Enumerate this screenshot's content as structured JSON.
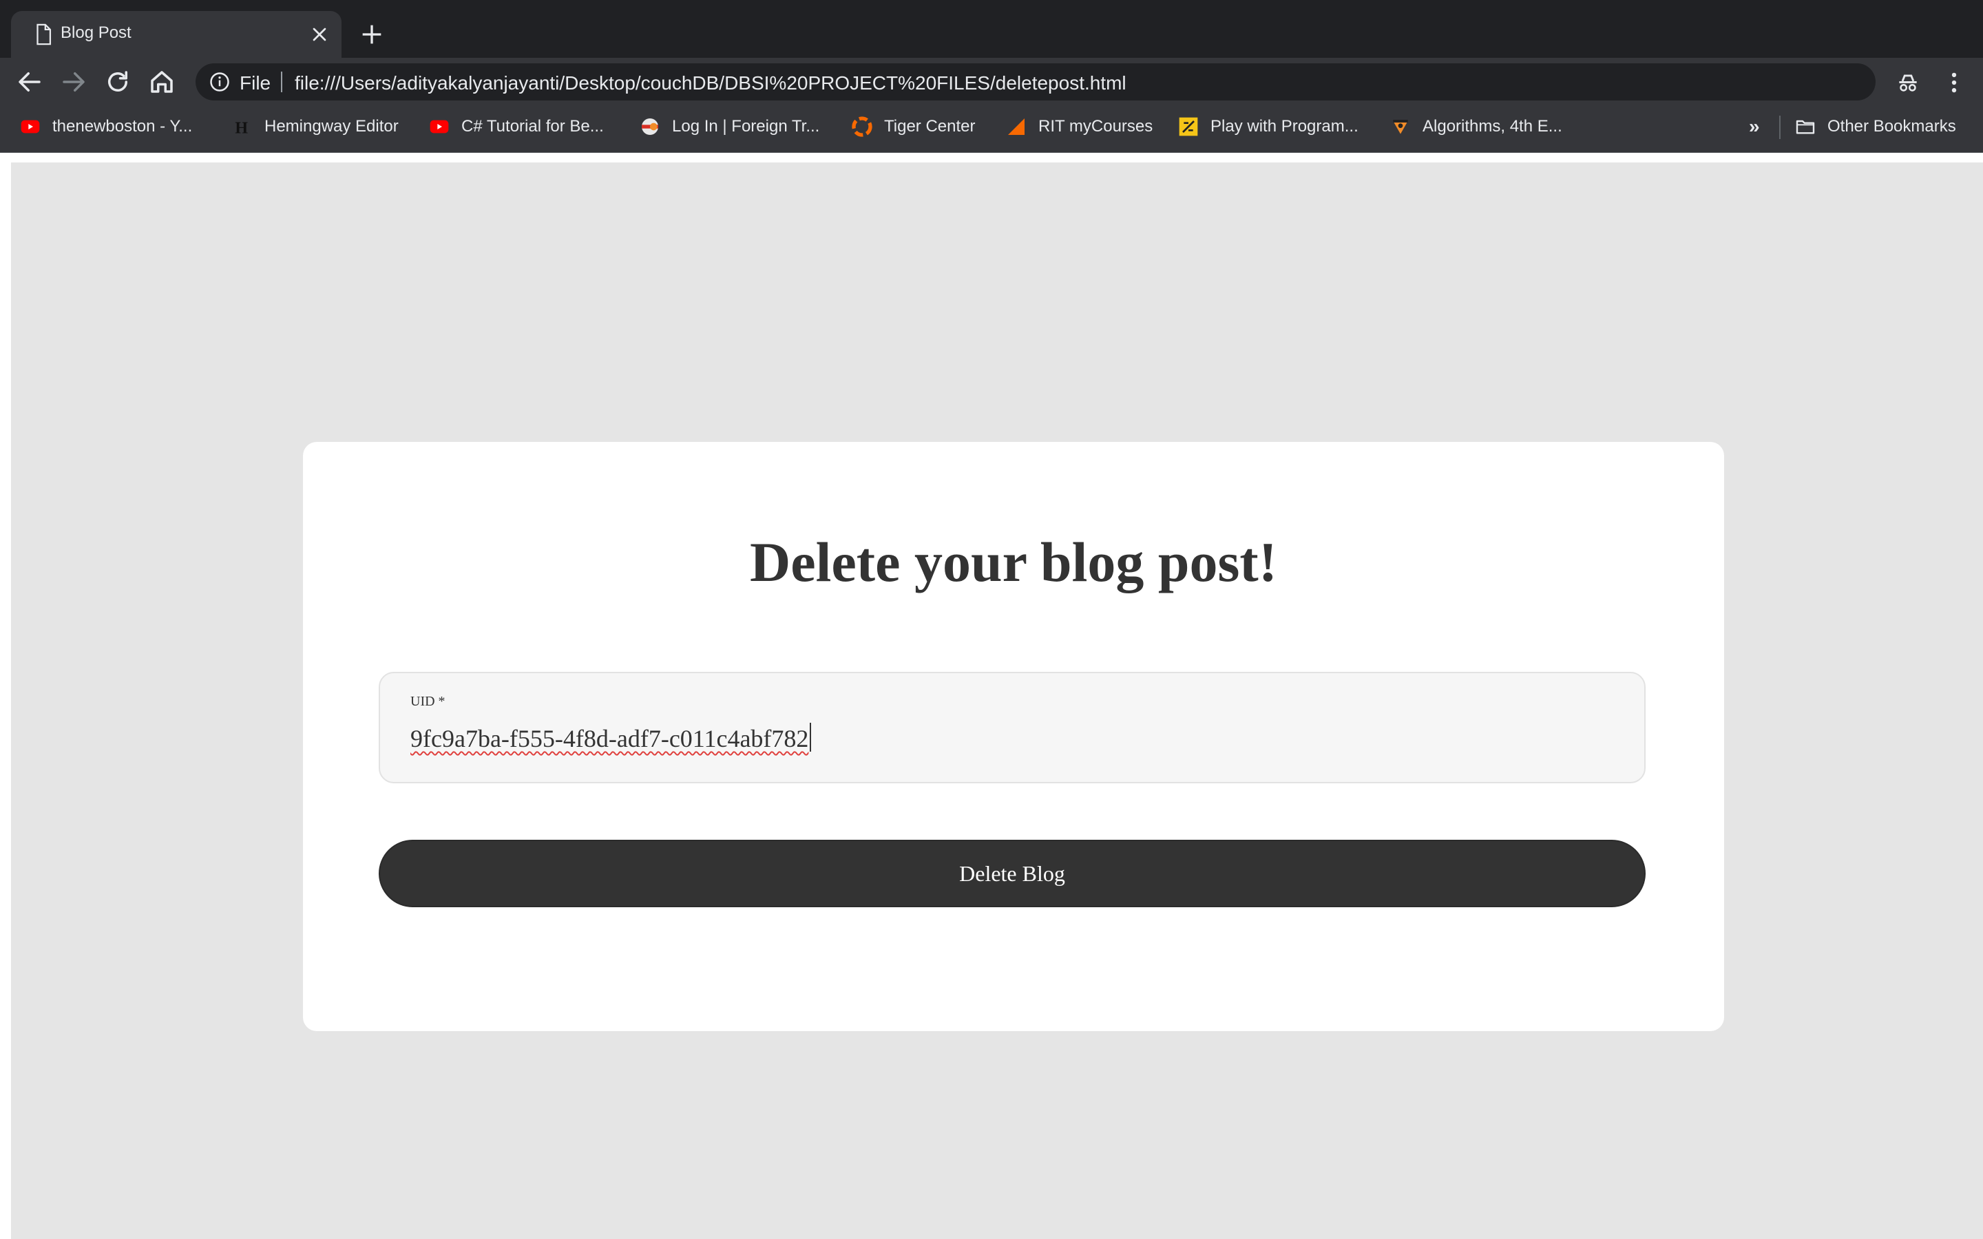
{
  "browser": {
    "tab": {
      "title": "Blog Post",
      "favicon": "document-icon"
    },
    "omnibox": {
      "scheme_label": "File",
      "url": "file:///Users/adityakalyanjayanti/Desktop/couchDB/DBSI%20PROJECT%20FILES/deletepost.html"
    },
    "bookmarks": [
      {
        "label": "thenewboston - Y...",
        "icon": "youtube-icon",
        "color": "#ff0000"
      },
      {
        "label": "Hemingway Editor",
        "icon": "hemingway-icon",
        "color": "#000000"
      },
      {
        "label": "C# Tutorial for Be...",
        "icon": "youtube-icon",
        "color": "#ff0000"
      },
      {
        "label": "Log In | Foreign Tr...",
        "icon": "foreign-trade-icon",
        "color": "#d93025"
      },
      {
        "label": "Tiger Center",
        "icon": "tiger-center-icon",
        "color": "#f76902"
      },
      {
        "label": "RIT myCourses",
        "icon": "mycourses-icon",
        "color": "#f76902"
      },
      {
        "label": "Play with Program...",
        "icon": "program-icon",
        "color": "#f5c518"
      },
      {
        "label": "Algorithms, 4th E...",
        "icon": "algorithms-icon",
        "color": "#f28c28"
      }
    ],
    "bookmarks_overflow": "»",
    "other_bookmarks": "Other Bookmarks"
  },
  "page": {
    "heading": "Delete your blog post!",
    "uid_field": {
      "label": "UID *",
      "value": "9fc9a7ba-f555-4f8d-adf7-c011c4abf782"
    },
    "delete_button": "Delete Blog"
  }
}
